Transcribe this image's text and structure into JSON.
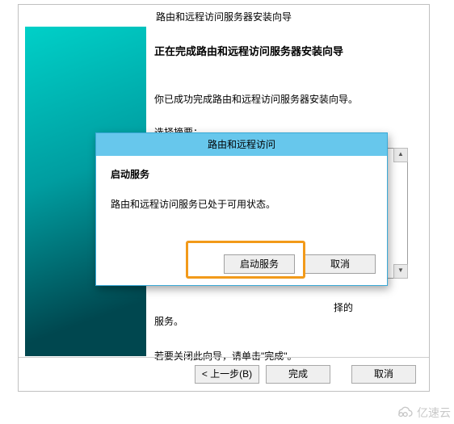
{
  "wizard": {
    "title": "路由和远程访问服务器安装向导",
    "heading": "正在完成路由和远程访问服务器安装向导",
    "success_msg": "你已成功完成路由和远程访问服务器安装向导。",
    "summary_label": "选择摘要：",
    "tail_suffix": "择的",
    "tail_line": "服务。",
    "close_hint": "若要关闭此向导，请单击\"完成\"。",
    "buttons": {
      "back": "< 上一步(B)",
      "finish": "完成",
      "cancel": "取消"
    }
  },
  "dialog": {
    "title": "路由和远程访问",
    "heading": "启动服务",
    "message": "路由和远程访问服务已处于可用状态。",
    "buttons": {
      "start": "启动服务",
      "cancel": "取消"
    }
  },
  "watermark": {
    "text": "亿速云"
  }
}
